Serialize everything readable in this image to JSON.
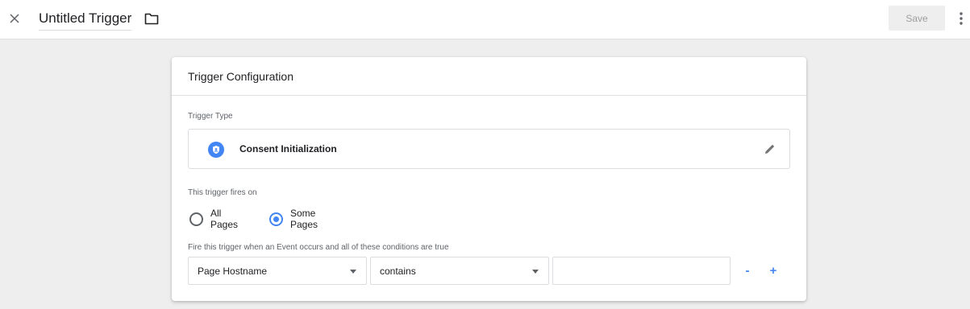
{
  "header": {
    "title": "Untitled Trigger",
    "save_label": "Save"
  },
  "card": {
    "title": "Trigger Configuration",
    "trigger_type_label": "Trigger Type",
    "trigger_type_name": "Consent Initialization",
    "fires_on_label": "This trigger fires on",
    "radio_all_pages": "All Pages",
    "radio_some_pages": "Some Pages",
    "selected_option": "Some Pages",
    "conditions_label": "Fire this trigger when an Event occurs and all of these conditions are true",
    "condition": {
      "variable": "Page Hostname",
      "operator": "contains",
      "value": ""
    },
    "remove_label": "-",
    "add_label": "+"
  },
  "colors": {
    "accent": "#4285f4",
    "background": "#eeeeee",
    "card": "#ffffff"
  },
  "icons": [
    "close-icon",
    "folder-icon",
    "more-vert-icon",
    "shield-icon",
    "pencil-icon",
    "dropdown-arrow-icon"
  ]
}
